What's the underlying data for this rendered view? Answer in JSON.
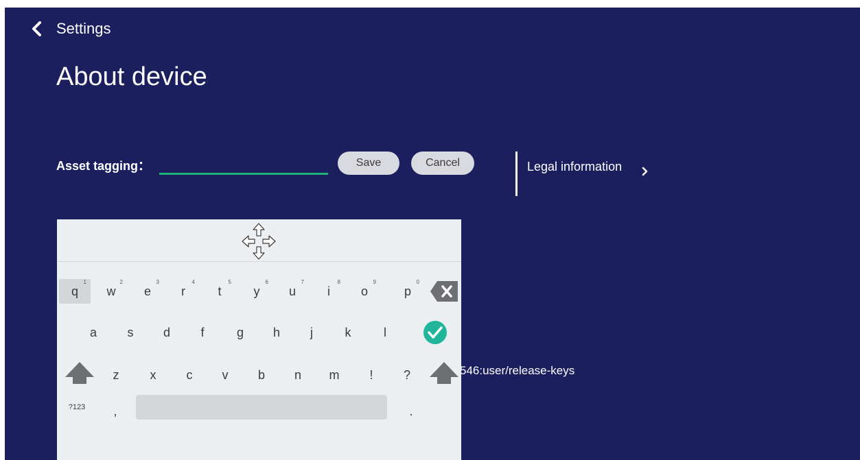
{
  "header": {
    "back_icon": "chevron-left-icon",
    "nav_label": "Settings",
    "title": "About device"
  },
  "asset_tagging": {
    "label": "Asset tagging：",
    "value": "",
    "save_label": "Save",
    "cancel_label": "Cancel"
  },
  "legal": {
    "label": "Legal information",
    "chevron_icon": "chevron-right-icon"
  },
  "build": {
    "partial_text": "546:user/release-keys"
  },
  "keyboard": {
    "move_icon": "move-arrows-icon",
    "row1": [
      {
        "key": "q",
        "hint": "1"
      },
      {
        "key": "w",
        "hint": "2"
      },
      {
        "key": "e",
        "hint": "3"
      },
      {
        "key": "r",
        "hint": "4"
      },
      {
        "key": "t",
        "hint": "5"
      },
      {
        "key": "y",
        "hint": "6"
      },
      {
        "key": "u",
        "hint": "7"
      },
      {
        "key": "i",
        "hint": "8"
      },
      {
        "key": "o",
        "hint": "9"
      },
      {
        "key": "p",
        "hint": "0"
      }
    ],
    "row2": [
      "a",
      "s",
      "d",
      "f",
      "g",
      "h",
      "j",
      "k",
      "l"
    ],
    "row3": [
      "z",
      "x",
      "c",
      "v",
      "b",
      "n",
      "m",
      "!",
      "?"
    ],
    "row4": {
      "symbols": "?123",
      "comma": ",",
      "period": "."
    },
    "backspace_icon": "backspace-icon",
    "enter_icon": "checkmark-icon",
    "shift_icon": "shift-arrow-icon",
    "colors": {
      "background": "#1c1f5e",
      "accent": "#1fb37a",
      "check": "#21b59b"
    }
  }
}
